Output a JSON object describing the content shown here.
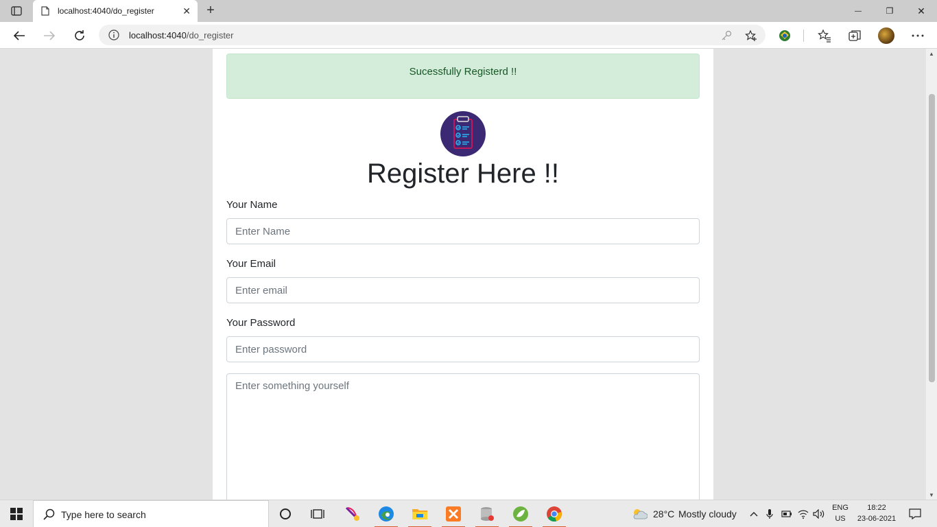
{
  "browser": {
    "tab": {
      "title": "localhost:4040/do_register",
      "close_glyph": "✕"
    },
    "new_tab_glyph": "+",
    "window_controls": {
      "minimize": "—",
      "restore": "❐",
      "close": "✕"
    },
    "address": {
      "host": "localhost:4040",
      "path": "/do_register"
    }
  },
  "page": {
    "alert": "Sucessfully Registerd !!",
    "heading": "Register Here !!",
    "form": {
      "name_label": "Your Name",
      "name_placeholder": "Enter Name",
      "email_label": "Your Email",
      "email_placeholder": "Enter email",
      "password_label": "Your Password",
      "password_placeholder": "Enter password",
      "about_placeholder": "Enter something yourself"
    },
    "colors": {
      "alert_bg": "#d4edda",
      "alert_text": "#155724",
      "logo_bg": "#3b2a73"
    }
  },
  "taskbar": {
    "search_placeholder": "Type here to search",
    "apps": [
      "cortana-icon",
      "task-view-icon",
      "feather-app-icon",
      "edge-icon",
      "file-explorer-icon",
      "xampp-icon",
      "database-app-icon",
      "spring-tools-icon",
      "chrome-icon"
    ],
    "weather": {
      "temp": "28°C",
      "condition": "Mostly cloudy"
    },
    "language": {
      "line1": "ENG",
      "line2": "US"
    },
    "clock": {
      "time": "18:22",
      "date": "23-06-2021"
    }
  }
}
